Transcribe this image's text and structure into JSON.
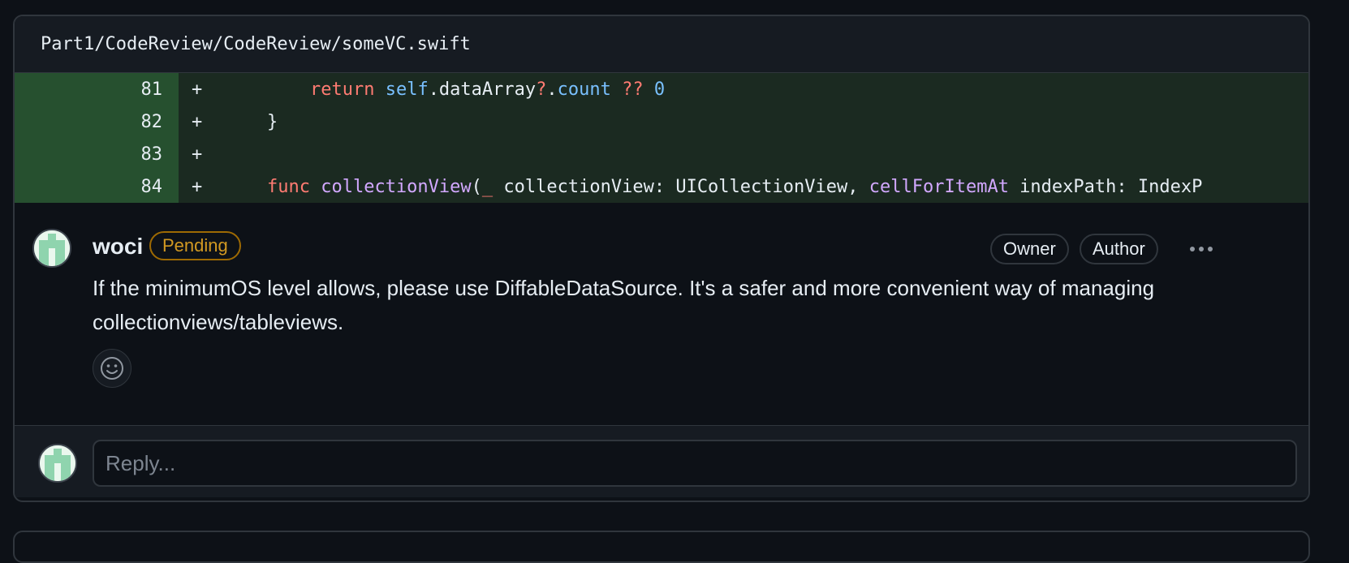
{
  "file": {
    "path": "Part1/CodeReview/CodeReview/someVC.swift"
  },
  "diff": {
    "lines": [
      {
        "num": "81",
        "marker": "+",
        "code": "        return self.dataArray?.count ?? 0"
      },
      {
        "num": "82",
        "marker": "+",
        "code": "    }"
      },
      {
        "num": "83",
        "marker": "+",
        "code": ""
      },
      {
        "num": "84",
        "marker": "+",
        "code": "    func collectionView(_ collectionView: UICollectionView, cellForItemAt indexPath: IndexP"
      }
    ]
  },
  "comment": {
    "author": "woci",
    "status": "Pending",
    "badges": [
      "Owner",
      "Author"
    ],
    "body": "If the minimumOS level allows, please use DiffableDataSource. It's a safer and more convenient way of managing collectionviews/tableviews.",
    "more_icon": "kebab-horizontal-icon",
    "reaction_icon": "smiley-icon"
  },
  "reply": {
    "placeholder": "Reply..."
  },
  "colors": {
    "added_bg": "#1b2a21",
    "added_num_bg": "#26502f",
    "pending": "#d29922",
    "keyword": "#ff7b72",
    "self": "#79c0ff",
    "function": "#d2a8ff"
  }
}
